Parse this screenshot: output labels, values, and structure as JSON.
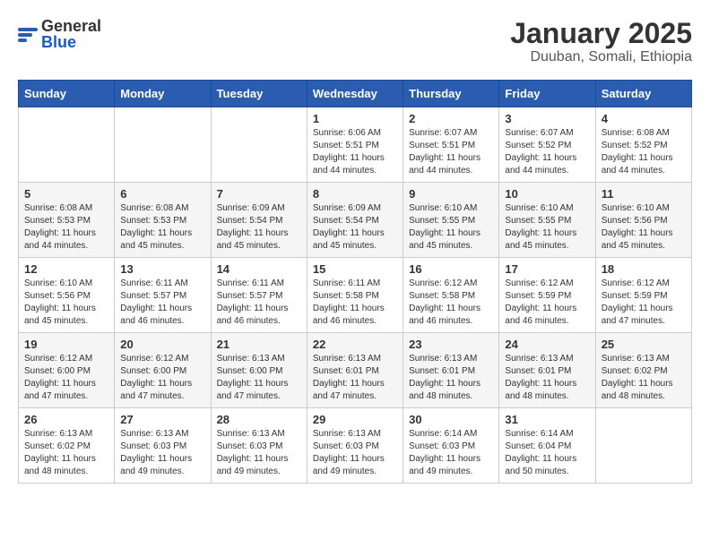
{
  "header": {
    "logo_general": "General",
    "logo_blue": "Blue",
    "title": "January 2025",
    "subtitle": "Duuban, Somali, Ethiopia"
  },
  "calendar": {
    "days_of_week": [
      "Sunday",
      "Monday",
      "Tuesday",
      "Wednesday",
      "Thursday",
      "Friday",
      "Saturday"
    ],
    "weeks": [
      [
        {
          "day": "",
          "info": ""
        },
        {
          "day": "",
          "info": ""
        },
        {
          "day": "",
          "info": ""
        },
        {
          "day": "1",
          "info": "Sunrise: 6:06 AM\nSunset: 5:51 PM\nDaylight: 11 hours\nand 44 minutes."
        },
        {
          "day": "2",
          "info": "Sunrise: 6:07 AM\nSunset: 5:51 PM\nDaylight: 11 hours\nand 44 minutes."
        },
        {
          "day": "3",
          "info": "Sunrise: 6:07 AM\nSunset: 5:52 PM\nDaylight: 11 hours\nand 44 minutes."
        },
        {
          "day": "4",
          "info": "Sunrise: 6:08 AM\nSunset: 5:52 PM\nDaylight: 11 hours\nand 44 minutes."
        }
      ],
      [
        {
          "day": "5",
          "info": "Sunrise: 6:08 AM\nSunset: 5:53 PM\nDaylight: 11 hours\nand 44 minutes."
        },
        {
          "day": "6",
          "info": "Sunrise: 6:08 AM\nSunset: 5:53 PM\nDaylight: 11 hours\nand 45 minutes."
        },
        {
          "day": "7",
          "info": "Sunrise: 6:09 AM\nSunset: 5:54 PM\nDaylight: 11 hours\nand 45 minutes."
        },
        {
          "day": "8",
          "info": "Sunrise: 6:09 AM\nSunset: 5:54 PM\nDaylight: 11 hours\nand 45 minutes."
        },
        {
          "day": "9",
          "info": "Sunrise: 6:10 AM\nSunset: 5:55 PM\nDaylight: 11 hours\nand 45 minutes."
        },
        {
          "day": "10",
          "info": "Sunrise: 6:10 AM\nSunset: 5:55 PM\nDaylight: 11 hours\nand 45 minutes."
        },
        {
          "day": "11",
          "info": "Sunrise: 6:10 AM\nSunset: 5:56 PM\nDaylight: 11 hours\nand 45 minutes."
        }
      ],
      [
        {
          "day": "12",
          "info": "Sunrise: 6:10 AM\nSunset: 5:56 PM\nDaylight: 11 hours\nand 45 minutes."
        },
        {
          "day": "13",
          "info": "Sunrise: 6:11 AM\nSunset: 5:57 PM\nDaylight: 11 hours\nand 46 minutes."
        },
        {
          "day": "14",
          "info": "Sunrise: 6:11 AM\nSunset: 5:57 PM\nDaylight: 11 hours\nand 46 minutes."
        },
        {
          "day": "15",
          "info": "Sunrise: 6:11 AM\nSunset: 5:58 PM\nDaylight: 11 hours\nand 46 minutes."
        },
        {
          "day": "16",
          "info": "Sunrise: 6:12 AM\nSunset: 5:58 PM\nDaylight: 11 hours\nand 46 minutes."
        },
        {
          "day": "17",
          "info": "Sunrise: 6:12 AM\nSunset: 5:59 PM\nDaylight: 11 hours\nand 46 minutes."
        },
        {
          "day": "18",
          "info": "Sunrise: 6:12 AM\nSunset: 5:59 PM\nDaylight: 11 hours\nand 47 minutes."
        }
      ],
      [
        {
          "day": "19",
          "info": "Sunrise: 6:12 AM\nSunset: 6:00 PM\nDaylight: 11 hours\nand 47 minutes."
        },
        {
          "day": "20",
          "info": "Sunrise: 6:12 AM\nSunset: 6:00 PM\nDaylight: 11 hours\nand 47 minutes."
        },
        {
          "day": "21",
          "info": "Sunrise: 6:13 AM\nSunset: 6:00 PM\nDaylight: 11 hours\nand 47 minutes."
        },
        {
          "day": "22",
          "info": "Sunrise: 6:13 AM\nSunset: 6:01 PM\nDaylight: 11 hours\nand 47 minutes."
        },
        {
          "day": "23",
          "info": "Sunrise: 6:13 AM\nSunset: 6:01 PM\nDaylight: 11 hours\nand 48 minutes."
        },
        {
          "day": "24",
          "info": "Sunrise: 6:13 AM\nSunset: 6:01 PM\nDaylight: 11 hours\nand 48 minutes."
        },
        {
          "day": "25",
          "info": "Sunrise: 6:13 AM\nSunset: 6:02 PM\nDaylight: 11 hours\nand 48 minutes."
        }
      ],
      [
        {
          "day": "26",
          "info": "Sunrise: 6:13 AM\nSunset: 6:02 PM\nDaylight: 11 hours\nand 48 minutes."
        },
        {
          "day": "27",
          "info": "Sunrise: 6:13 AM\nSunset: 6:03 PM\nDaylight: 11 hours\nand 49 minutes."
        },
        {
          "day": "28",
          "info": "Sunrise: 6:13 AM\nSunset: 6:03 PM\nDaylight: 11 hours\nand 49 minutes."
        },
        {
          "day": "29",
          "info": "Sunrise: 6:13 AM\nSunset: 6:03 PM\nDaylight: 11 hours\nand 49 minutes."
        },
        {
          "day": "30",
          "info": "Sunrise: 6:14 AM\nSunset: 6:03 PM\nDaylight: 11 hours\nand 49 minutes."
        },
        {
          "day": "31",
          "info": "Sunrise: 6:14 AM\nSunset: 6:04 PM\nDaylight: 11 hours\nand 50 minutes."
        },
        {
          "day": "",
          "info": ""
        }
      ]
    ]
  }
}
